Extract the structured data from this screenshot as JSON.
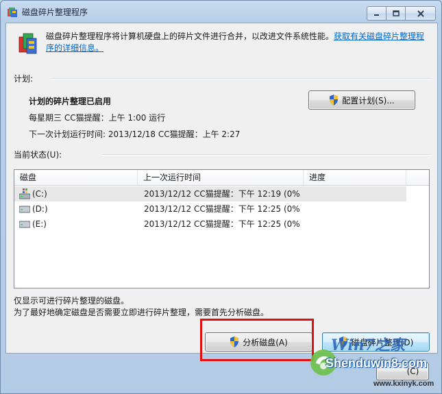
{
  "window": {
    "title": "磁盘碎片整理程序",
    "caption_buttons": [
      "minimize",
      "maximize",
      "close"
    ]
  },
  "header": {
    "description": "磁盘碎片整理程序将计算机硬盘上的碎片文件进行合并，以改进文件系统性能。",
    "link_text_line1": "获取有关磁盘碎片整理程",
    "link_text_line2": "序的详细信息。"
  },
  "schedule": {
    "section_label": "计划:",
    "status": "计划的碎片整理已启用",
    "frequency": "每星期三  CC猫提醒：上午 1:00 运行",
    "next_run": "下一次计划运行时间: 2013/12/18 CC猫提醒：上午 2:27",
    "configure_button": "配置计划(S)..."
  },
  "current_status": {
    "section_label": "当前状态(U):",
    "columns": [
      "磁盘",
      "上一次运行时间",
      "进度"
    ],
    "rows": [
      {
        "disk": "(C:)",
        "last_run": "2013/12/12 CC猫提醒：下午 12:19 (0%...",
        "progress": "",
        "icon": "system-drive-icon"
      },
      {
        "disk": "(D:)",
        "last_run": "2013/12/12 CC猫提醒：下午 12:25 (0%...",
        "progress": "",
        "icon": "drive-icon"
      },
      {
        "disk": "(E:)",
        "last_run": "2013/12/12 CC猫提醒：下午 12:25 (0%...",
        "progress": "",
        "icon": "drive-icon"
      }
    ]
  },
  "notes": {
    "line1": "仅显示可进行碎片整理的磁盘。",
    "line2": "为了最好地确定磁盘是否需要立即进行碎片整理，需要首先分析磁盘。"
  },
  "actions": {
    "analyze_button": "分析磁盘(A)",
    "defrag_button": "磁盘碎片整理(D)"
  },
  "watermark": {
    "brand": "Win7之家",
    "site": "Shenduwin8.com",
    "url": "www.kxinyk.com",
    "close_partial": "(C)"
  }
}
